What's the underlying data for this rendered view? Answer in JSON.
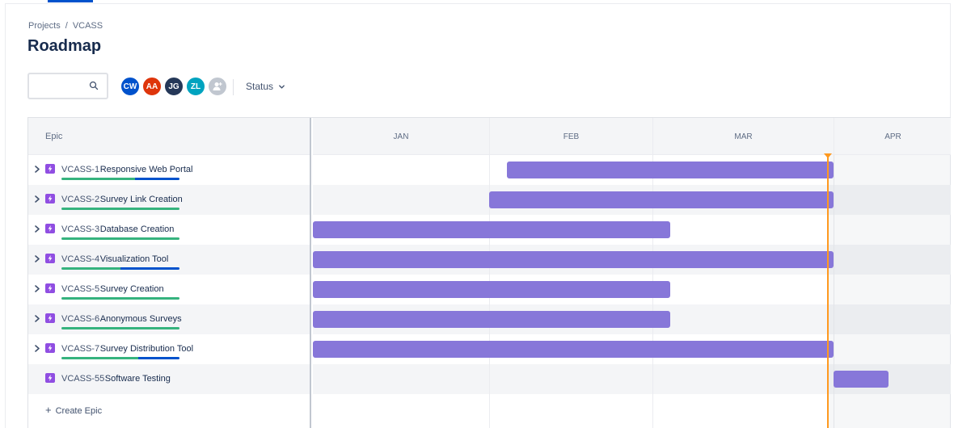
{
  "breadcrumb": {
    "projects": "Projects",
    "separator": "/",
    "project": "VCASS"
  },
  "page_title": "Roadmap",
  "search": {
    "value": "",
    "placeholder": "",
    "icon": "search-icon"
  },
  "avatars": [
    {
      "initials": "CW",
      "color": "#0052cc"
    },
    {
      "initials": "AA",
      "color": "#de350b"
    },
    {
      "initials": "JG",
      "color": "#253858"
    },
    {
      "initials": "ZL",
      "color": "#00a3bf"
    },
    {
      "initials": "",
      "color": "#c1c7d0",
      "icon": "add-person-icon"
    }
  ],
  "status_filter": {
    "label": "Status",
    "icon": "chevron-down-icon"
  },
  "table": {
    "epic_header": "Epic",
    "months": [
      "JAN",
      "FEB",
      "MAR",
      "APR"
    ],
    "create_epic": "Create Epic"
  },
  "epics": [
    {
      "key": "VCASS-1",
      "name": "Responsive Web Portal",
      "expandable": true,
      "progress": {
        "done": 0.62,
        "in_progress": 0.38
      },
      "timeline": {
        "start": "Feb 4",
        "end": "Apr 1"
      }
    },
    {
      "key": "VCASS-2",
      "name": "Survey Link Creation",
      "expandable": true,
      "progress": {
        "done": 1.0,
        "in_progress": 0.0
      },
      "timeline": {
        "start": "Feb 1",
        "end": "Apr 1"
      }
    },
    {
      "key": "VCASS-3",
      "name": "Database Creation",
      "expandable": true,
      "progress": {
        "done": 1.0,
        "in_progress": 0.0
      },
      "timeline": {
        "start": "Jan 1",
        "end": "Mar 4"
      }
    },
    {
      "key": "VCASS-4",
      "name": "Visualization Tool",
      "expandable": true,
      "progress": {
        "done": 0.5,
        "in_progress": 0.5
      },
      "timeline": {
        "start": "Jan 1",
        "end": "Apr 1"
      }
    },
    {
      "key": "VCASS-5",
      "name": "Survey Creation",
      "expandable": true,
      "progress": {
        "done": 1.0,
        "in_progress": 0.0
      },
      "timeline": {
        "start": "Jan 1",
        "end": "Mar 4"
      }
    },
    {
      "key": "VCASS-6",
      "name": "Anonymous Surveys",
      "expandable": true,
      "progress": {
        "done": 1.0,
        "in_progress": 0.0
      },
      "timeline": {
        "start": "Jan 1",
        "end": "Mar 4"
      }
    },
    {
      "key": "VCASS-7",
      "name": "Survey Distribution Tool",
      "expandable": true,
      "progress": {
        "done": 0.65,
        "in_progress": 0.35
      },
      "timeline": {
        "start": "Jan 1",
        "end": "Apr 1"
      }
    },
    {
      "key": "VCASS-55",
      "name": "Software Testing",
      "expandable": false,
      "progress": null,
      "timeline": {
        "start": "Apr 1",
        "end": "Apr 15"
      }
    }
  ],
  "today": "Mar 31",
  "colors": {
    "bar": "#8777d9",
    "today": "#ff991f",
    "done": "#36b37e",
    "in_progress": "#0052cc",
    "epic_icon": "#904ee2"
  }
}
